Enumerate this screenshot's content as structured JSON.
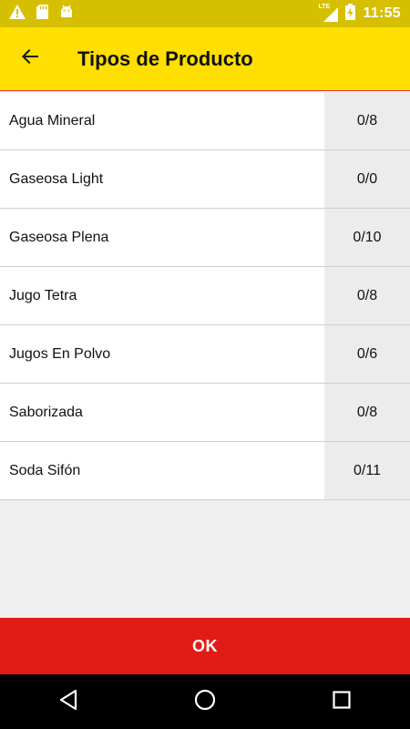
{
  "status_bar": {
    "time": "11:55",
    "network": "LTE",
    "icons": [
      "warning-icon",
      "sd-card-icon",
      "android-icon",
      "signal-icon",
      "battery-charging-icon"
    ]
  },
  "app_bar": {
    "title": "Tipos de Producto",
    "back_icon": "arrow-back-icon"
  },
  "products": [
    {
      "name": "Agua Mineral",
      "count": "0/8"
    },
    {
      "name": "Gaseosa Light",
      "count": "0/0"
    },
    {
      "name": "Gaseosa Plena",
      "count": "0/10"
    },
    {
      "name": "Jugo Tetra",
      "count": "0/8"
    },
    {
      "name": "Jugos En Polvo",
      "count": "0/6"
    },
    {
      "name": "Saborizada",
      "count": "0/8"
    },
    {
      "name": "Soda Sifón",
      "count": "0/11"
    }
  ],
  "footer": {
    "ok_label": "OK"
  },
  "nav_bar": {
    "icons": [
      "back-triangle-icon",
      "home-circle-icon",
      "recents-square-icon"
    ]
  },
  "colors": {
    "status_bar": "#d6bf00",
    "app_bar": "#ffdf00",
    "ok_button": "#e31b17",
    "count_cell": "#ececec"
  }
}
